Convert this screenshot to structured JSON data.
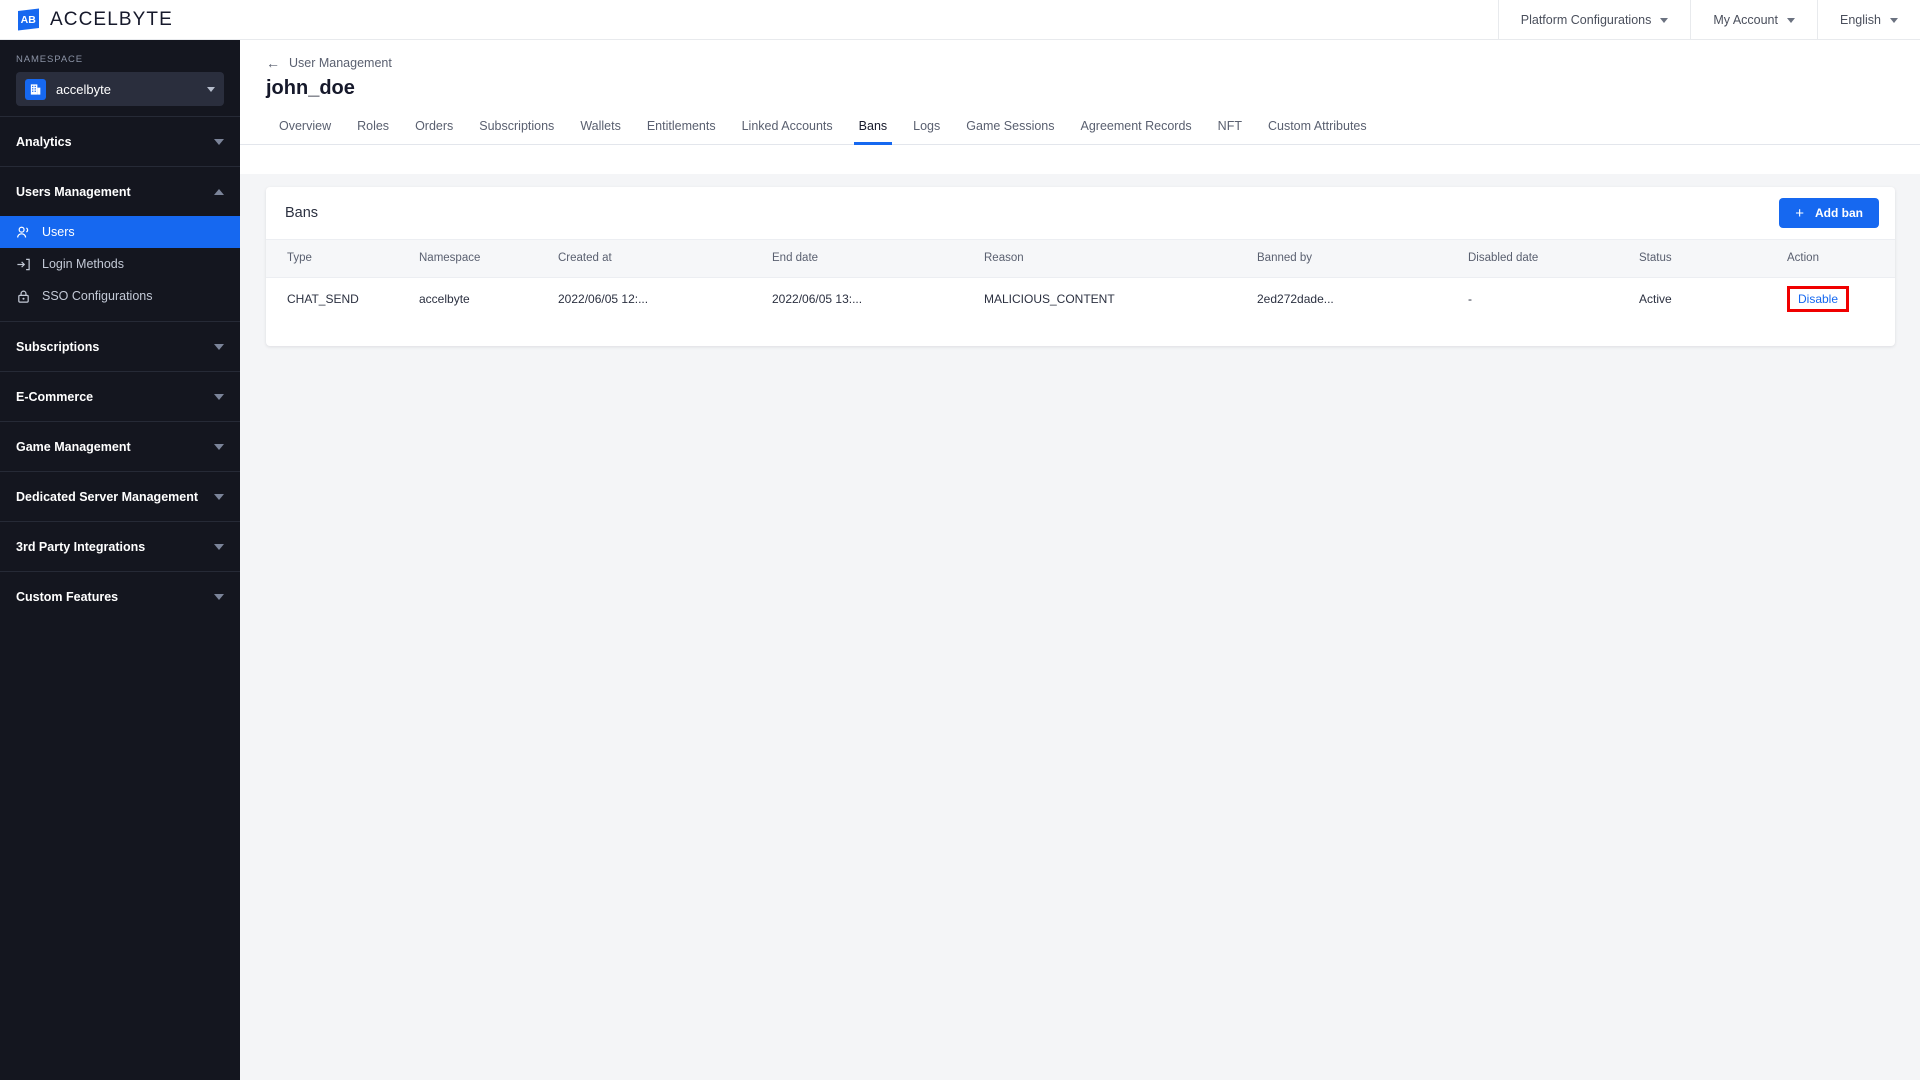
{
  "header": {
    "brand_name": "ACCELBYTE",
    "brand_logo_icon": "accelbyte-logo-icon",
    "menus": [
      {
        "label": "Platform Configurations",
        "icon": "chevron-down-icon"
      },
      {
        "label": "My Account",
        "icon": "chevron-down-icon"
      },
      {
        "label": "English",
        "icon": "chevron-down-icon"
      }
    ]
  },
  "sidebar": {
    "namespace_label": "NAMESPACE",
    "namespace_value": "accelbyte",
    "namespace_icon": "building-icon",
    "namespace_caret_icon": "chevron-down-icon",
    "groups": [
      {
        "label": "Analytics",
        "expanded": false,
        "caret_icon": "triangle-down-icon",
        "items": []
      },
      {
        "label": "Users Management",
        "expanded": true,
        "caret_icon": "triangle-up-icon",
        "items": [
          {
            "label": "Users",
            "icon": "users-icon",
            "active": true
          },
          {
            "label": "Login Methods",
            "icon": "login-arrow-icon",
            "active": false
          },
          {
            "label": "SSO Configurations",
            "icon": "lock-icon",
            "active": false
          }
        ]
      },
      {
        "label": "Subscriptions",
        "expanded": false,
        "caret_icon": "triangle-down-icon",
        "items": []
      },
      {
        "label": "E-Commerce",
        "expanded": false,
        "caret_icon": "triangle-down-icon",
        "items": []
      },
      {
        "label": "Game Management",
        "expanded": false,
        "caret_icon": "triangle-down-icon",
        "items": []
      },
      {
        "label": "Dedicated Server Management",
        "expanded": false,
        "caret_icon": "triangle-down-icon",
        "items": []
      },
      {
        "label": "3rd Party Integrations",
        "expanded": false,
        "caret_icon": "triangle-down-icon",
        "items": []
      },
      {
        "label": "Custom Features",
        "expanded": false,
        "caret_icon": "triangle-down-icon",
        "items": []
      }
    ]
  },
  "main": {
    "breadcrumb_label": "User Management",
    "breadcrumb_icon": "arrow-left-icon",
    "page_title": "john_doe",
    "tabs": [
      {
        "label": "Overview",
        "active": false
      },
      {
        "label": "Roles",
        "active": false
      },
      {
        "label": "Orders",
        "active": false
      },
      {
        "label": "Subscriptions",
        "active": false
      },
      {
        "label": "Wallets",
        "active": false
      },
      {
        "label": "Entitlements",
        "active": false
      },
      {
        "label": "Linked Accounts",
        "active": false
      },
      {
        "label": "Bans",
        "active": true
      },
      {
        "label": "Logs",
        "active": false
      },
      {
        "label": "Game Sessions",
        "active": false
      },
      {
        "label": "Agreement Records",
        "active": false
      },
      {
        "label": "NFT",
        "active": false
      },
      {
        "label": "Custom Attributes",
        "active": false
      }
    ],
    "card": {
      "title": "Bans",
      "add_button_label": "Add ban",
      "add_button_icon": "plus-icon",
      "accent_color": "#1668f0",
      "columns": [
        "Type",
        "Namespace",
        "Created at",
        "End date",
        "Reason",
        "Banned by",
        "Disabled date",
        "Status",
        "Action"
      ],
      "rows": [
        {
          "type": "CHAT_SEND",
          "namespace": "accelbyte",
          "created_at": "2022/06/05 12:...",
          "end_date": "2022/06/05 13:...",
          "reason": "MALICIOUS_CONTENT",
          "banned_by": "2ed272dade...",
          "disabled_date": "-",
          "status": "Active",
          "action_label": "Disable",
          "action_highlighted": true,
          "highlight_color": "#f00000"
        }
      ]
    }
  }
}
